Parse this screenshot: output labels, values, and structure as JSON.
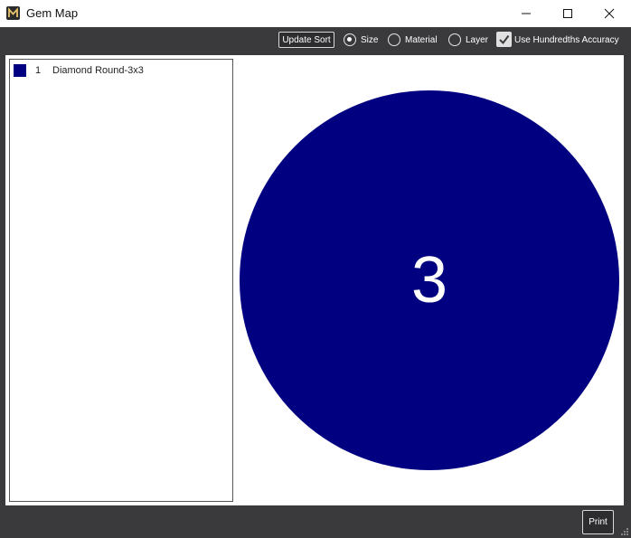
{
  "window": {
    "title": "Gem Map",
    "icon": "m-logo-icon"
  },
  "toolbar": {
    "update_sort_label": "Update Sort",
    "sort_options": [
      {
        "label": "Size",
        "selected": true
      },
      {
        "label": "Material",
        "selected": false
      },
      {
        "label": "Layer",
        "selected": false
      }
    ],
    "hundredths_label": "Use Hundredths Accuracy",
    "hundredths_checked": true
  },
  "legend": {
    "items": [
      {
        "number": "1",
        "name": "Diamond Round-3x3",
        "color": "#000080"
      }
    ]
  },
  "gem_map": {
    "gems": [
      {
        "label": "3",
        "shape": "circle",
        "color": "#000080"
      }
    ]
  },
  "footer": {
    "print_label": "Print"
  }
}
